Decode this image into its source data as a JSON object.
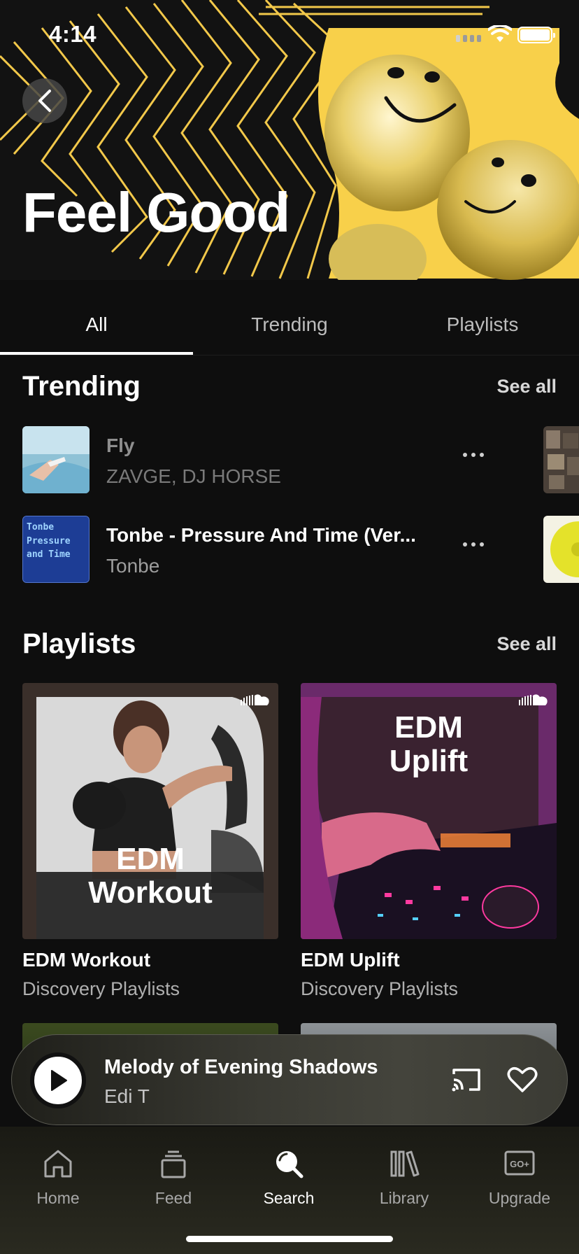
{
  "status_bar": {
    "time": "4:14"
  },
  "hero": {
    "title": "Feel Good",
    "accent_color": "#f8d04a"
  },
  "tabs": [
    {
      "label": "All",
      "active": true
    },
    {
      "label": "Trending",
      "active": false
    },
    {
      "label": "Playlists",
      "active": false
    }
  ],
  "trending": {
    "title": "Trending",
    "see_all": "See all",
    "tracks": [
      {
        "title": "Fly",
        "artist": "ZAVGE, DJ HORSE",
        "state": "dimmed"
      },
      {
        "title": "Tonbe - Pressure And Time (Ver...",
        "artist": "Tonbe",
        "cover_text": "Tonbe Pressure and Time"
      }
    ]
  },
  "playlists": {
    "title": "Playlists",
    "see_all": "See all",
    "items": [
      {
        "name": "EDM Workout",
        "subtitle": "Discovery Playlists",
        "cover_line1": "EDM",
        "cover_line2": "Workout"
      },
      {
        "name": "EDM Uplift",
        "subtitle": "Discovery Playlists",
        "cover_line1": "EDM",
        "cover_line2": "Uplift"
      }
    ]
  },
  "mini_player": {
    "title": "Melody of Evening Shadows",
    "artist": "Edi T"
  },
  "nav": [
    {
      "label": "Home",
      "icon": "home-icon"
    },
    {
      "label": "Feed",
      "icon": "feed-icon"
    },
    {
      "label": "Search",
      "icon": "search-icon",
      "active": true
    },
    {
      "label": "Library",
      "icon": "library-icon"
    },
    {
      "label": "Upgrade",
      "icon": "upgrade-icon"
    }
  ]
}
